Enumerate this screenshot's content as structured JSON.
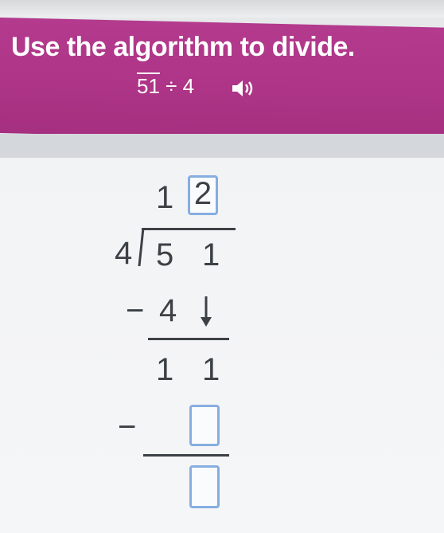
{
  "header": {
    "title": "Use the algorithm to divide.",
    "expression_num": "51",
    "expression_op": "÷",
    "expression_div": "4",
    "audio_icon": "speaker-icon"
  },
  "division": {
    "divisor": "4",
    "dividend_digits": [
      "5",
      "1"
    ],
    "quotient_digits": [
      "1",
      "2"
    ],
    "minus": "−",
    "first_subtract": "4",
    "bring_down_icon": "down-arrow-icon",
    "remainder_digits": [
      "1",
      "1"
    ],
    "second_minus": "−"
  },
  "inputs": {
    "subtract_box_value": "",
    "result_box_value": ""
  },
  "colors": {
    "header": "#ad3486",
    "box_border": "#86aee0",
    "digit": "#3c4146"
  }
}
